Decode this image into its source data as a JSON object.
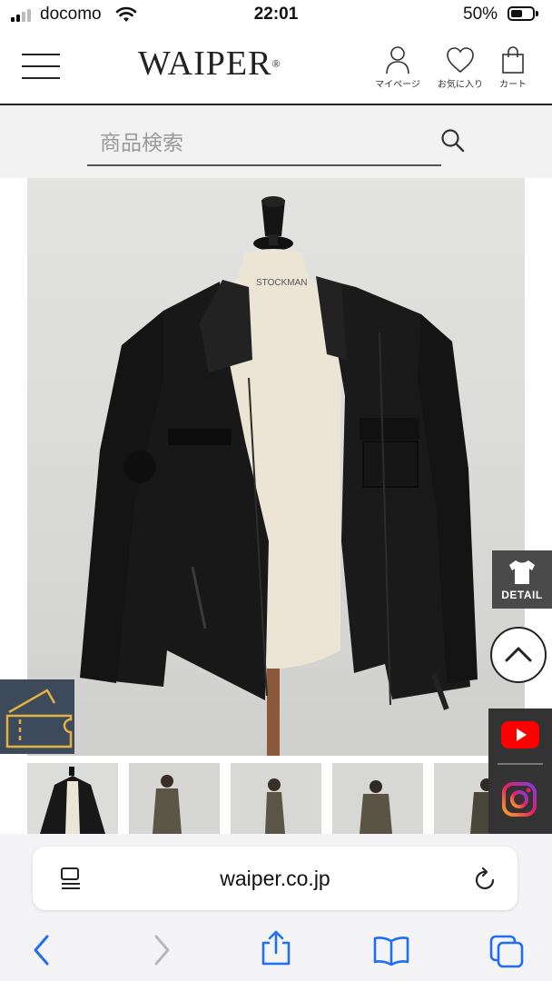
{
  "status_bar": {
    "carrier": "docomo",
    "time": "22:01",
    "battery_percent": "50%",
    "battery_level": 0.5,
    "signal_bars": 2
  },
  "header": {
    "logo": "WAIPER",
    "logo_mark": "®",
    "mypage_label": "マイページ",
    "favorites_label": "お気に入り",
    "cart_label": "カート"
  },
  "search": {
    "placeholder": "商品検索"
  },
  "product": {
    "mannequin_label": "STOCKMAN",
    "thumbnail_count": 5,
    "selected_thumbnail": 0
  },
  "floating": {
    "detail_label": "DETAIL"
  },
  "browser": {
    "url": "waiper.co.jp"
  },
  "icons": {
    "menu": "hamburger-icon",
    "mypage": "person-icon",
    "favorites": "heart-icon",
    "cart": "bag-icon",
    "search": "search-icon",
    "detail": "tshirt-icon",
    "top": "chevron-up-icon",
    "coupon": "ticket-icon",
    "youtube": "youtube-icon",
    "instagram": "instagram-icon",
    "reader": "reader-icon",
    "reload": "reload-icon",
    "back": "chevron-left-icon",
    "forward": "chevron-right-icon",
    "share": "share-icon",
    "bookmarks": "book-icon",
    "tabs": "tabs-icon"
  },
  "colors": {
    "accent_blue": "#1e6ff5",
    "header_border": "#222222",
    "search_bg": "#f2f2f2",
    "detail_bg": "#4a4a4a",
    "coupon_bg": "#3d4a5c",
    "coupon_line": "#e3b341",
    "youtube_red": "#ff0000"
  }
}
